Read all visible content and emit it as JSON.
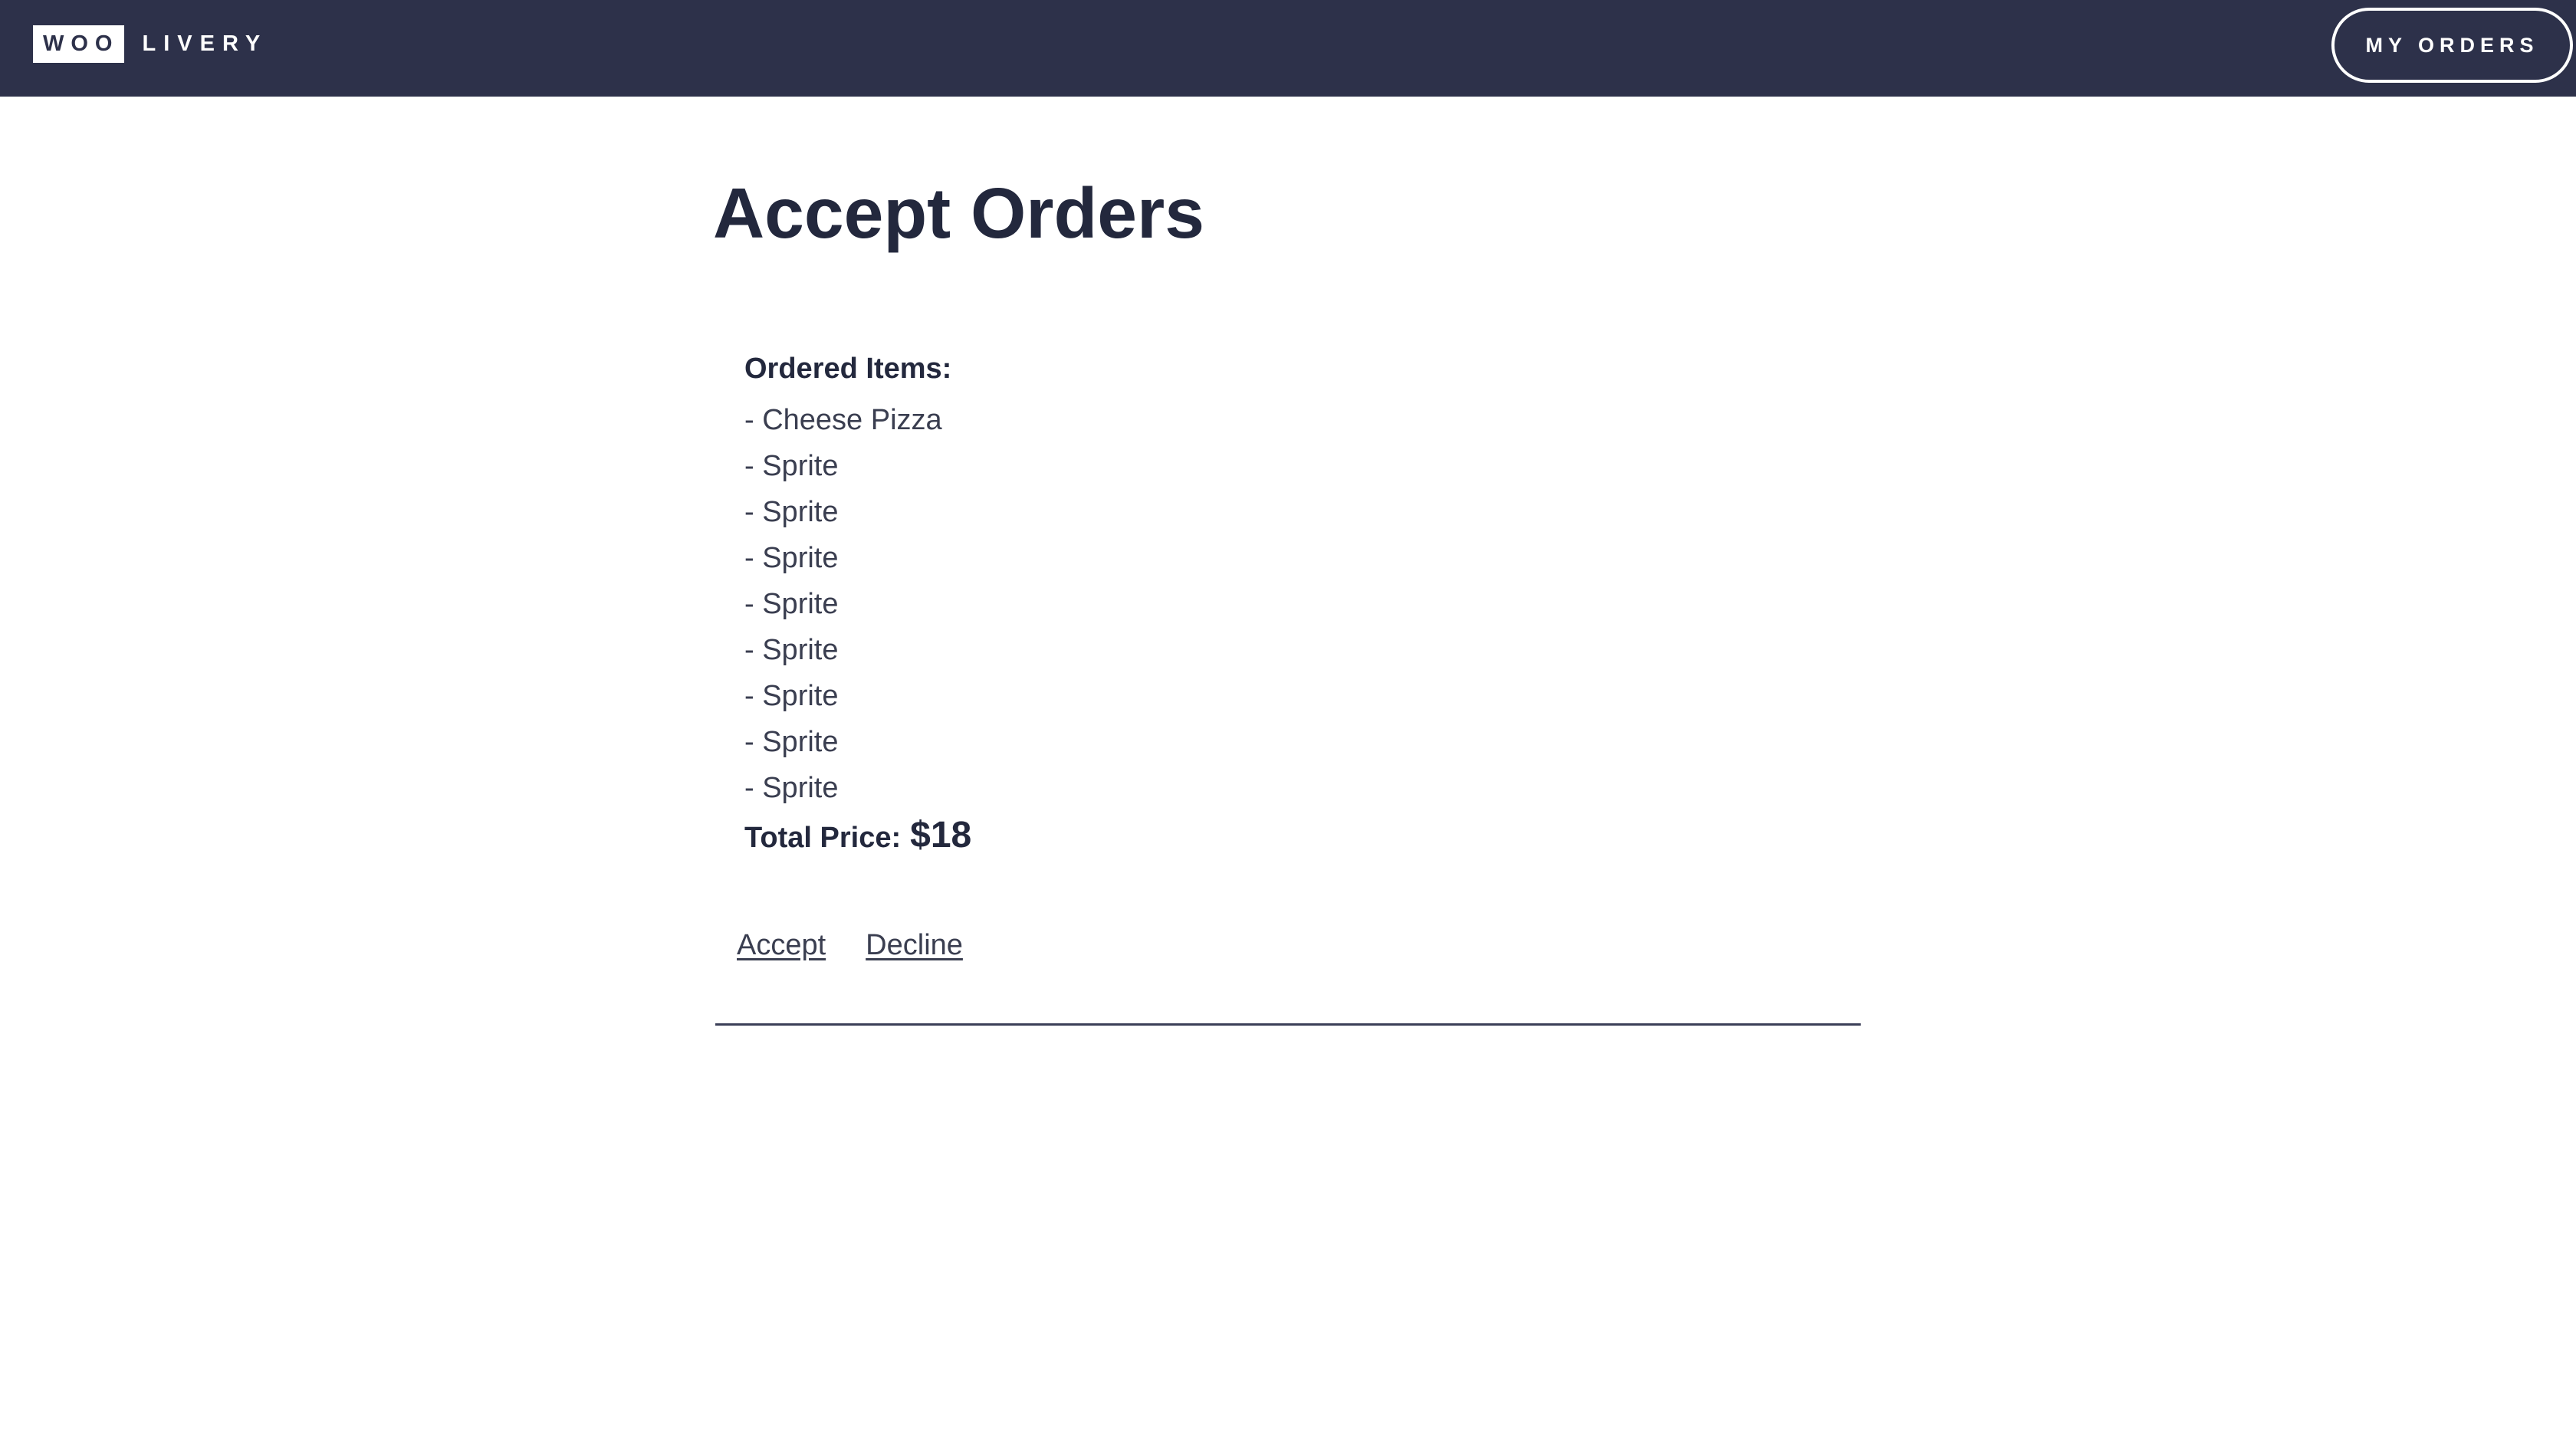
{
  "header": {
    "logo_box": "WOO",
    "logo_text": "LIVERY",
    "my_orders_label": "MY ORDERS"
  },
  "main": {
    "title": "Accept Orders",
    "order": {
      "items_heading": "Ordered Items:",
      "items": [
        "- Cheese Pizza",
        "- Sprite",
        "- Sprite",
        "- Sprite",
        "- Sprite",
        "- Sprite",
        "- Sprite",
        "- Sprite",
        "- Sprite"
      ],
      "total_label": "Total Price:",
      "total_value": "$18",
      "accept_label": "Accept",
      "decline_label": "Decline"
    }
  },
  "colors": {
    "header_bg": "#2d314a",
    "text": "#23283d",
    "divider": "#3a3e57"
  }
}
